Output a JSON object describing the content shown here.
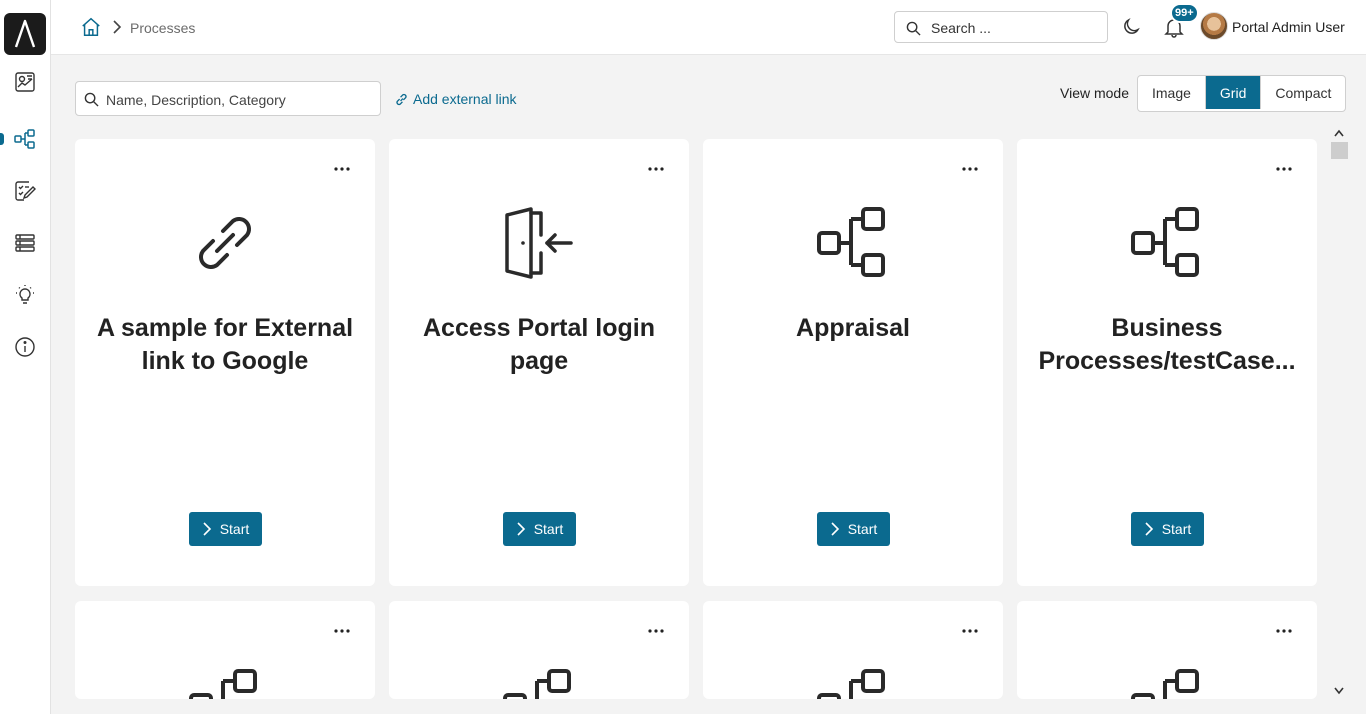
{
  "breadcrumb": {
    "current": "Processes"
  },
  "header": {
    "search_placeholder": "Search ...",
    "notification_count": "99+",
    "user_name": "Portal Admin User"
  },
  "toolbar": {
    "filter_placeholder": "Name, Description, Category",
    "add_external_link": "Add external link",
    "view_mode_label": "View mode",
    "view_modes": [
      "Image",
      "Grid",
      "Compact"
    ],
    "selected_view_mode": "Grid"
  },
  "sidebar": {
    "items": [
      {
        "icon": "dashboard-icon"
      },
      {
        "icon": "process-icon",
        "active": true
      },
      {
        "icon": "task-list-icon"
      },
      {
        "icon": "case-list-icon"
      },
      {
        "icon": "lightbulb-icon"
      },
      {
        "icon": "info-icon"
      }
    ]
  },
  "cards": [
    {
      "title": "A sample for External link to Google",
      "icon": "link-icon",
      "start_label": "Start"
    },
    {
      "title": "Access Portal login page",
      "icon": "door-enter-icon",
      "start_label": "Start"
    },
    {
      "title": "Appraisal",
      "icon": "process-flow-icon",
      "start_label": "Start"
    },
    {
      "title": "Business Processes/testCase...",
      "icon": "process-flow-icon",
      "start_label": "Start"
    }
  ],
  "colors": {
    "accent": "#0b6a8f",
    "background": "#f3f3f3",
    "card": "#ffffff"
  }
}
